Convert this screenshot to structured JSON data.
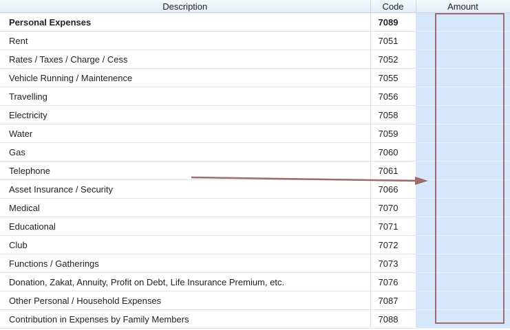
{
  "columns": {
    "description": "Description",
    "code": "Code",
    "amount": "Amount"
  },
  "rows": [
    {
      "label": "Personal Expenses",
      "code": "7089",
      "amount": "",
      "bold": true
    },
    {
      "label": "Rent",
      "code": "7051",
      "amount": ""
    },
    {
      "label": "Rates / Taxes / Charge / Cess",
      "code": "7052",
      "amount": ""
    },
    {
      "label": "Vehicle Running / Maintenence",
      "code": "7055",
      "amount": ""
    },
    {
      "label": "Travelling",
      "code": "7056",
      "amount": ""
    },
    {
      "label": "Electricity",
      "code": "7058",
      "amount": ""
    },
    {
      "label": "Water",
      "code": "7059",
      "amount": ""
    },
    {
      "label": "Gas",
      "code": "7060",
      "amount": ""
    },
    {
      "label": "Telephone",
      "code": "7061",
      "amount": ""
    },
    {
      "label": "Asset Insurance / Security",
      "code": "7066",
      "amount": ""
    },
    {
      "label": "Medical",
      "code": "7070",
      "amount": ""
    },
    {
      "label": "Educational",
      "code": "7071",
      "amount": ""
    },
    {
      "label": "Club",
      "code": "7072",
      "amount": ""
    },
    {
      "label": "Functions / Gatherings",
      "code": "7073",
      "amount": ""
    },
    {
      "label": "Donation, Zakat, Annuity, Profit on Debt, Life Insurance Premium, etc.",
      "code": "7076",
      "amount": ""
    },
    {
      "label": "Other Personal / Household Expenses",
      "code": "7087",
      "amount": ""
    },
    {
      "label": "Contribution in Expenses by Family Members",
      "code": "7088",
      "amount": ""
    }
  ],
  "annotation": {
    "color": "#9c6b6b",
    "highlight_color": "#d6e7fb"
  }
}
